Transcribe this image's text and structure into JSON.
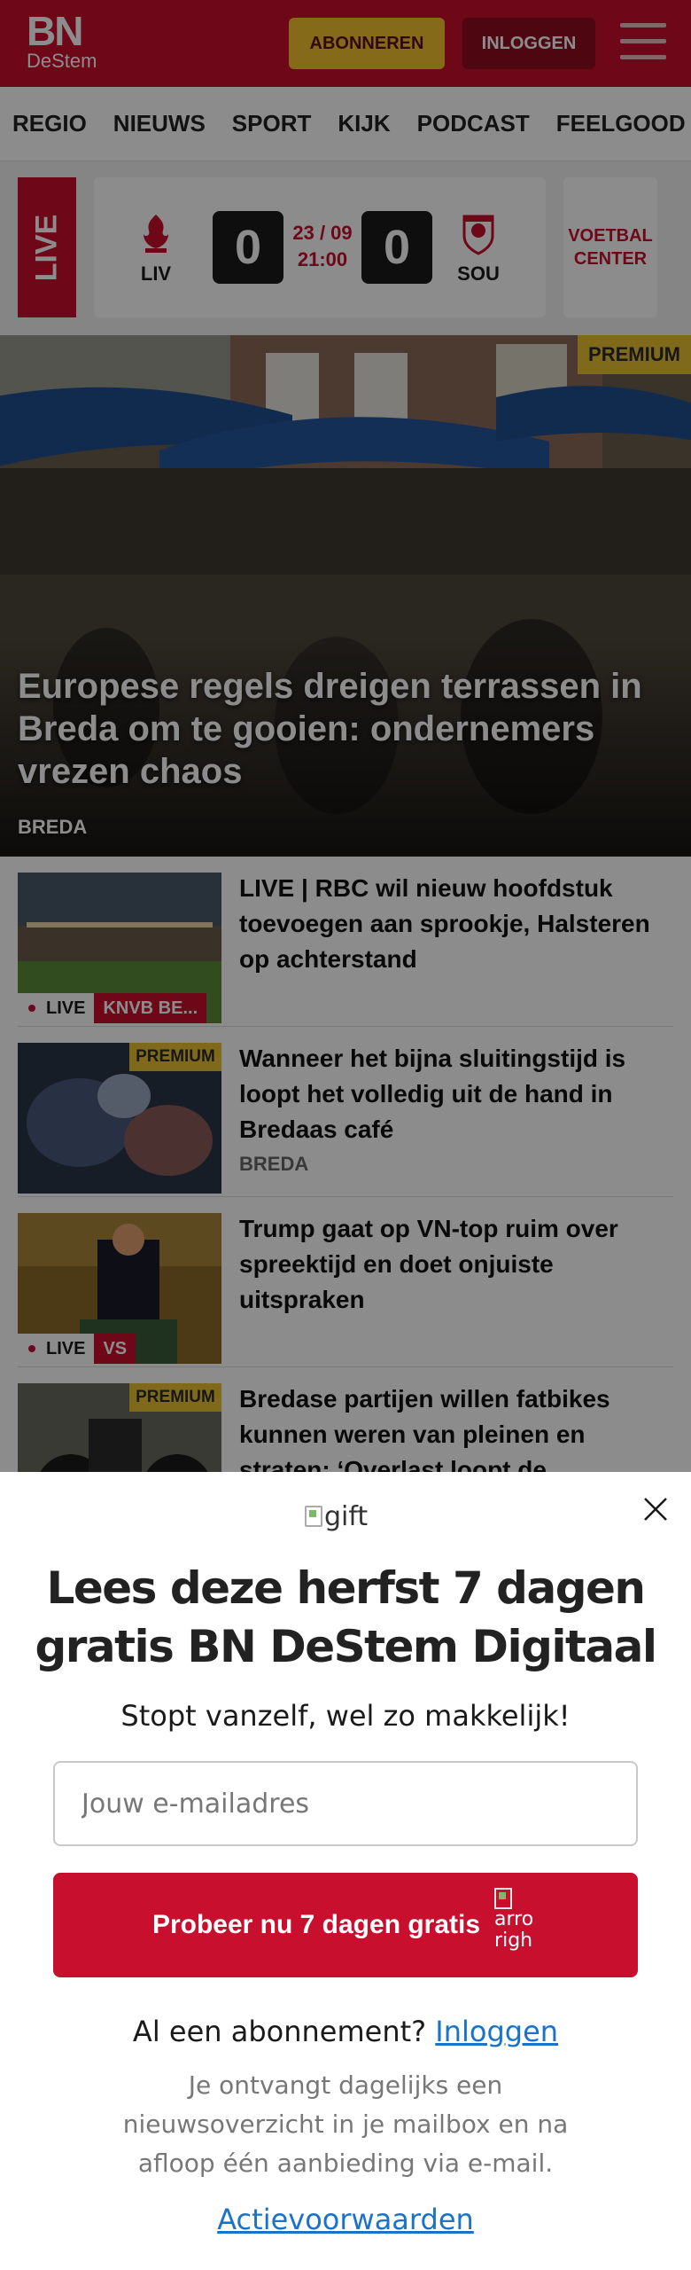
{
  "header": {
    "logo_main": "BN",
    "logo_sub": "DeStem",
    "subscribe_label": "ABONNEREN",
    "login_label": "INLOGGEN",
    "brand_color": "#c8102e",
    "icons": [
      "menu-icon"
    ]
  },
  "nav": {
    "items": [
      "REGIO",
      "NIEUWS",
      "SPORT",
      "KIJK",
      "PODCAST",
      "FEELGOOD"
    ]
  },
  "live_match": {
    "live_label": "LIVE",
    "home_team": "LIV",
    "away_team": "SOU",
    "home_score": "0",
    "away_score": "0",
    "date": "23 / 09",
    "time": "21:00",
    "center_label": "VOETBAL CENTER"
  },
  "hero": {
    "badge": "PREMIUM",
    "title": "Europese regels dreigen terrassen in Breda om te gooien: ondernemers vrezen chaos",
    "category": "BREDA"
  },
  "articles": [
    {
      "title": "LIVE | RBC wil nieuw hoofdstuk toevoegen aan sprookje, Halsteren op achterstand",
      "live_tag": "LIVE",
      "tag": "KNVB BE...",
      "badge": "",
      "category": ""
    },
    {
      "title": "Wanneer het bijna sluitingstijd is loopt het volledig uit de hand in Bredaas café",
      "live_tag": "",
      "tag": "",
      "badge": "PREMIUM",
      "category": "BREDA"
    },
    {
      "title": "Trump gaat op VN-top ruim over spreektijd en doet onjuiste uitspraken",
      "live_tag": "LIVE",
      "tag": "VS",
      "badge": "",
      "category": ""
    },
    {
      "title": "Bredase partijen willen fatbikes kunnen weren van pleinen en straten: ‘Overlast loopt de",
      "live_tag": "",
      "tag": "",
      "badge": "PREMIUM",
      "category": ""
    }
  ],
  "modal": {
    "gift_alt": "gift",
    "title": "Lees deze herfst 7 dagen gratis BN DeStem Digitaal",
    "subtitle": "Stopt vanzelf, wel zo makkelijk!",
    "email_placeholder": "Jouw e-mailadres",
    "email_value": "",
    "cta_label": "Probeer nu 7 dagen gratis",
    "cta_arrow_alt": "arrow-right",
    "cta_arrow_alt_line1": "arro",
    "cta_arrow_alt_line2": "righ",
    "login_prompt": "Al een abonnement?",
    "login_link": "Inloggen",
    "info_text": "Je ontvangt dagelijks een nieuwsoverzicht in je mailbox en na afloop één aanbieding via e-mail.",
    "terms_link": "Actievoorwaarden"
  }
}
